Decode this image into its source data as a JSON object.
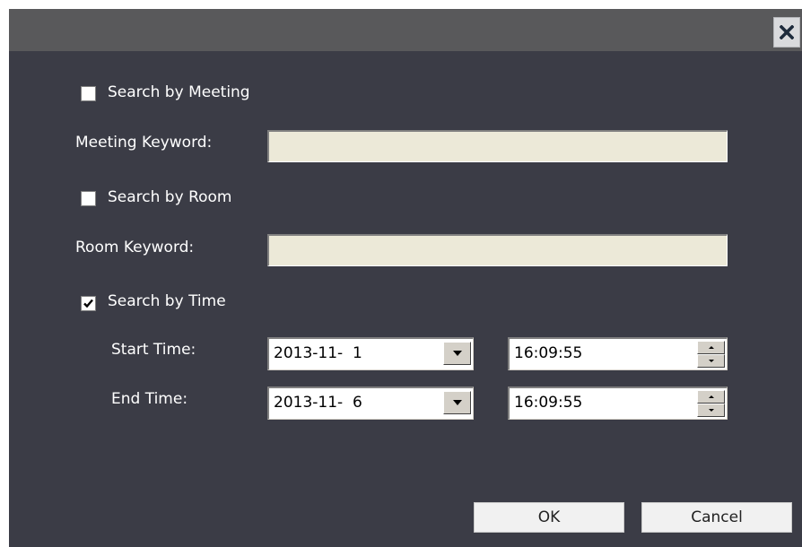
{
  "titlebar": {
    "close_icon": "close-icon"
  },
  "meeting": {
    "checkbox_label": "Search by Meeting",
    "checked": false,
    "keyword_label": "Meeting Keyword:",
    "keyword_value": ""
  },
  "room": {
    "checkbox_label": "Search by Room",
    "checked": false,
    "keyword_label": "Room Keyword:",
    "keyword_value": ""
  },
  "time": {
    "checkbox_label": "Search by Time",
    "checked": true,
    "start_label": "Start Time:",
    "start_date": "2013-11-  1",
    "start_time": "16:09:55",
    "end_label": "End Time:",
    "end_date": "2013-11-  6",
    "end_time": "16:09:55"
  },
  "buttons": {
    "ok": "OK",
    "cancel": "Cancel"
  },
  "colors": {
    "dialog_bg": "#3b3c46",
    "titlebar_bg": "#59595b",
    "field_disabled_bg": "#ece9d8",
    "button_bg": "#f1f1f1"
  }
}
